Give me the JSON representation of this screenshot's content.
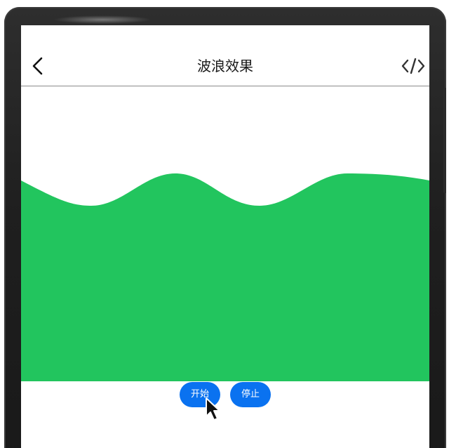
{
  "nav": {
    "title": "波浪效果",
    "back_icon": "chevron-left-icon",
    "code_icon": "code-icon"
  },
  "wave": {
    "color": "#22c55e"
  },
  "controls": {
    "start_label": "开始",
    "stop_label": "停止",
    "button_color": "#0a72f0"
  }
}
